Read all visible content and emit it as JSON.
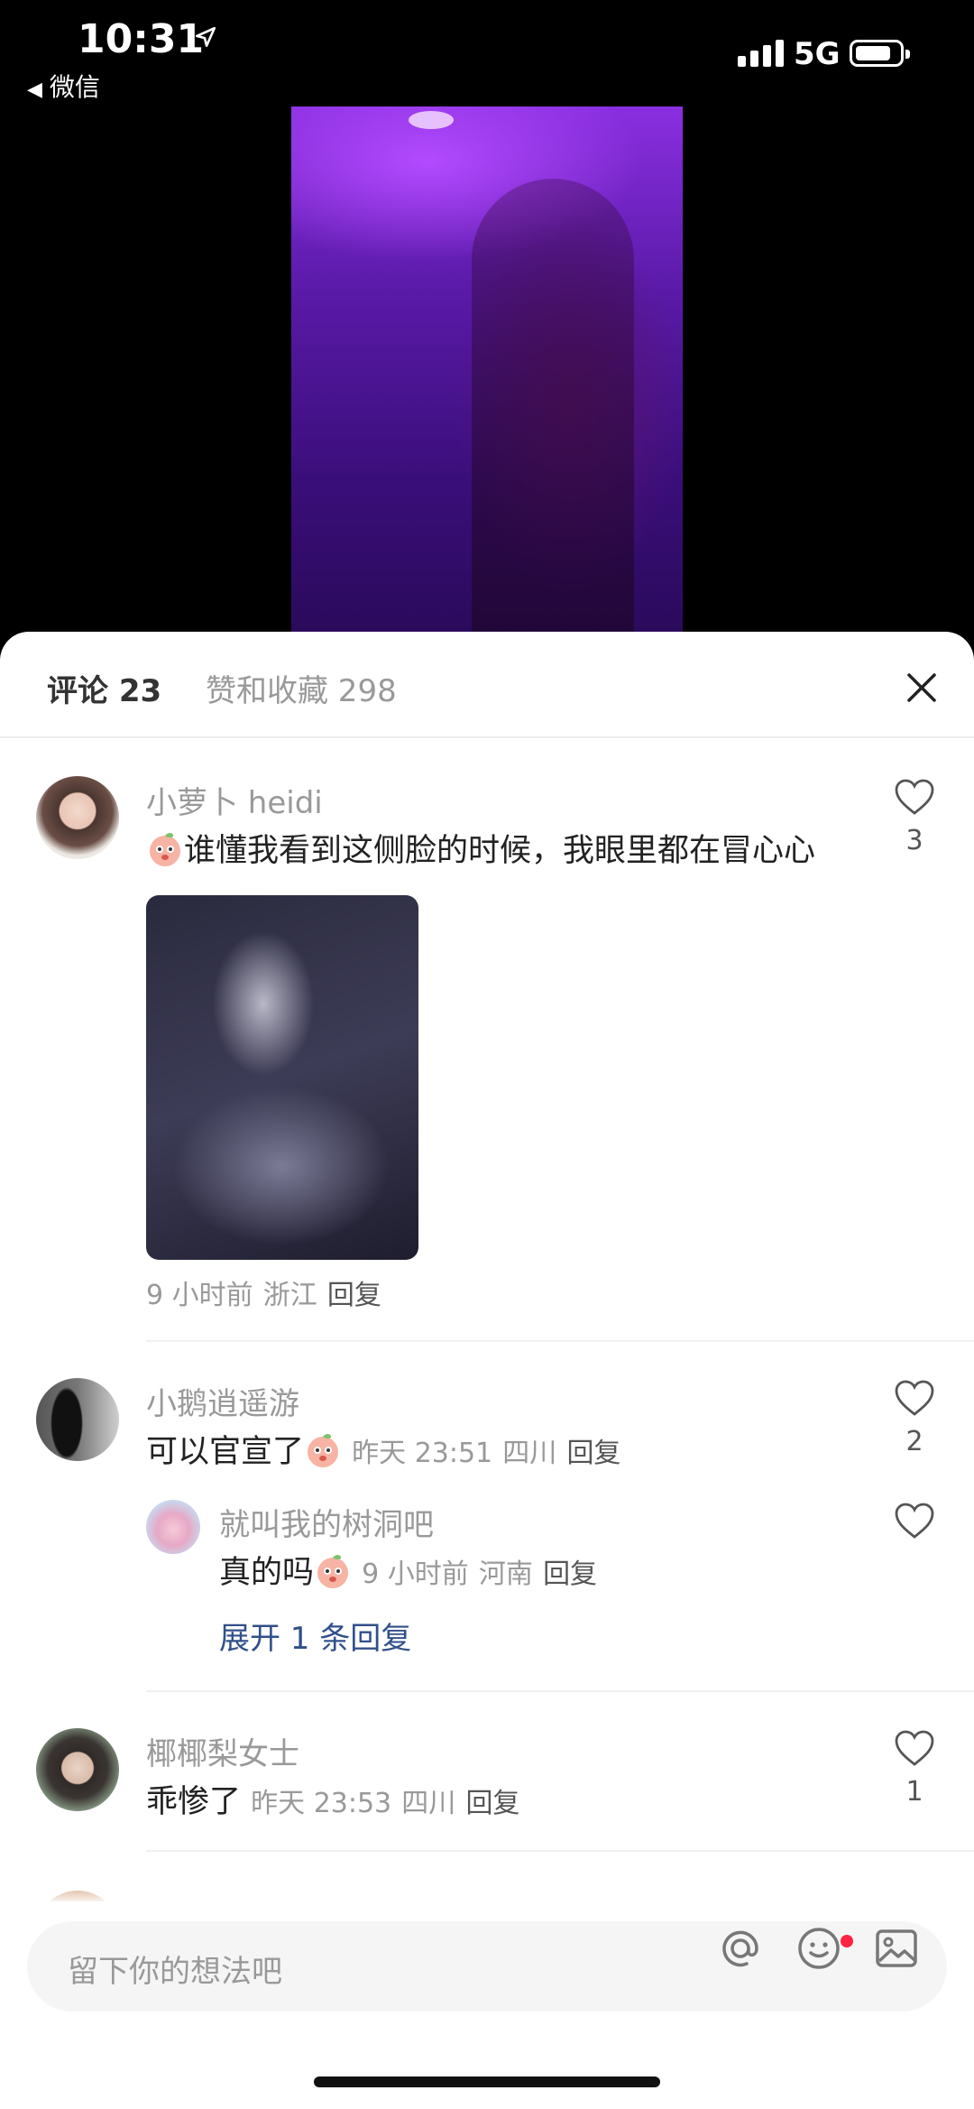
{
  "status_bar": {
    "time": "10:31",
    "back_label": "微信",
    "network": "5G"
  },
  "tabs": {
    "comments_label": "评论 23",
    "likes_label": "赞和收藏 298"
  },
  "comments": [
    {
      "username": "小萝卜 heidi",
      "text": "谁懂我看到这侧脸的时候，我眼里都在冒心心",
      "time": "9 小时前",
      "location": "浙江",
      "reply_label": "回复",
      "like_count": "3"
    },
    {
      "username": "小鹅逍遥游",
      "text": "可以官宣了",
      "time": "昨天 23:51",
      "location": "四川",
      "reply_label": "回复",
      "like_count": "2",
      "sub_reply": {
        "username": "就叫我的树洞吧",
        "text": "真的吗",
        "time": "9 小时前",
        "location": "河南",
        "reply_label": "回复"
      },
      "expand_label": "展开 1 条回复"
    },
    {
      "username": "椰椰梨女士",
      "text": "乖惨了",
      "time": "昨天 23:53",
      "location": "四川",
      "reply_label": "回复",
      "like_count": "1"
    }
  ],
  "input": {
    "placeholder": "留下你的想法吧"
  },
  "colors": {
    "link": "#31508a",
    "badge": "#ff2442"
  }
}
